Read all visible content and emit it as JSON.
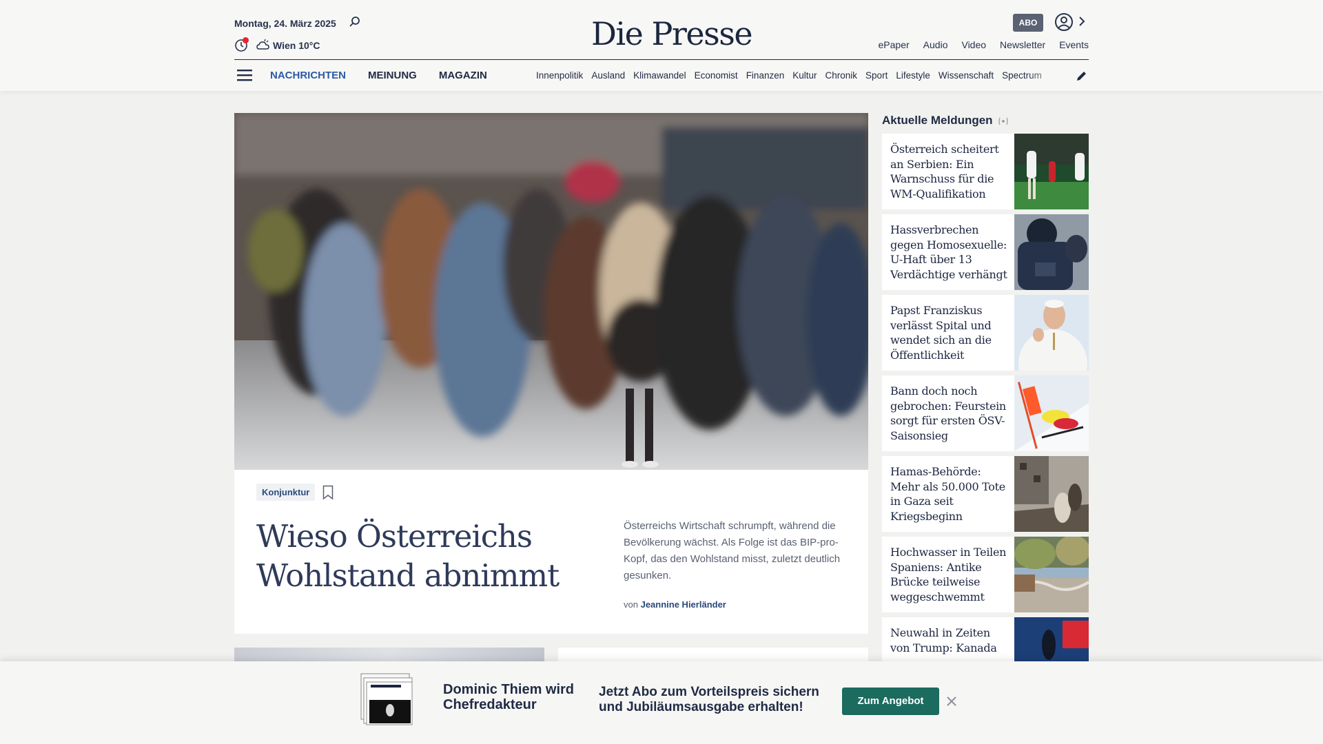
{
  "header": {
    "date": "Montag, 24. März 2025",
    "weather": "Wien 10°C",
    "logo": "Die Presse",
    "abo": "ABO",
    "quick_links": [
      "ePaper",
      "Audio",
      "Video",
      "Newsletter",
      "Events"
    ]
  },
  "nav": {
    "main": [
      "NACHRICHTEN",
      "MEINUNG",
      "MAGAZIN"
    ],
    "sub": [
      "Innenpolitik",
      "Ausland",
      "Klimawandel",
      "Economist",
      "Finanzen",
      "Kultur",
      "Chronik",
      "Sport",
      "Lifestyle",
      "Wissenschaft",
      "Spectrum"
    ]
  },
  "hero": {
    "tag": "Konjunktur",
    "title": "Wieso Österreichs Wohlstand abnimmt",
    "teaser": "Österreichs Wirtschaft schrumpft, während die Bevölkerung wächst. Als Folge ist das BIP-pro-Kopf, das den Wohlstand misst, zuletzt deutlich gesunken.",
    "byline_prefix": "von",
    "author": "Jeannine Hierländer"
  },
  "sidebar": {
    "title": "Aktuelle Meldungen",
    "items": [
      {
        "title": "Österreich scheitert an Serbien: Ein Warnschuss für die WM-Qualifikation"
      },
      {
        "title": "Hassverbrechen gegen Homosexuelle: U-Haft über 13 Verdächtige verhängt"
      },
      {
        "title": "Papst Franziskus verlässt Spital und wendet sich an die Öffentlichkeit"
      },
      {
        "title": "Bann doch noch gebrochen: Feurstein sorgt für ersten ÖSV-Saisonsieg"
      },
      {
        "title": "Hamas-Behörde: Mehr als 50.000 Tote in Gaza seit Kriegsbeginn"
      },
      {
        "title": "Hochwasser in Teilen Spaniens: Antike Brücke teilweise weggeschwemmt"
      },
      {
        "title": "Neuwahl in Zeiten von Trump: Kanada"
      }
    ]
  },
  "banner": {
    "headline": "Dominic Thiem wird Chefredakteur",
    "offer": "Jetzt Abo zum Vorteilspreis sichern und Jubiläumsausgabe erhalten!",
    "button": "Zum Angebot"
  },
  "colors": {
    "accent_blue": "#2a5aa6",
    "cta_green": "#1b6b5f",
    "alert_red": "#e3262f"
  }
}
